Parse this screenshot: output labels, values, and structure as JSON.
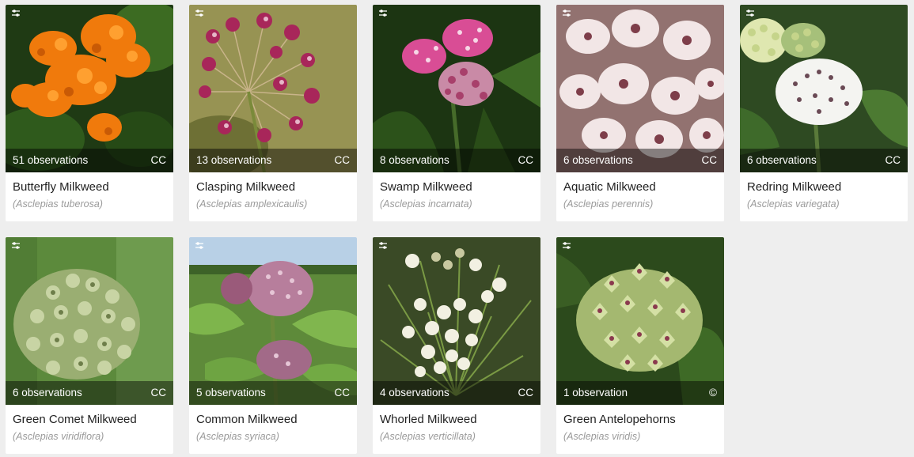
{
  "cards": [
    {
      "observations": "51 observations",
      "license": "CC",
      "common_name": "Butterfly Milkweed",
      "scientific_name": "(Asclepias tuberosa)",
      "photo": "orange-flower-cluster-photo"
    },
    {
      "observations": "13 observations",
      "license": "CC",
      "common_name": "Clasping Milkweed",
      "scientific_name": "(Asclepias amplexicaulis)",
      "photo": "pink-umbel-photo"
    },
    {
      "observations": "8 observations",
      "license": "CC",
      "common_name": "Swamp Milkweed",
      "scientific_name": "(Asclepias incarnata)",
      "photo": "magenta-flower-photo"
    },
    {
      "observations": "6 observations",
      "license": "CC",
      "common_name": "Aquatic Milkweed",
      "scientific_name": "(Asclepias perennis)",
      "photo": "white-pink-flower-photo"
    },
    {
      "observations": "6 observations",
      "license": "CC",
      "common_name": "Redring Milkweed",
      "scientific_name": "(Asclepias variegata)",
      "photo": "white-flower-ball-photo"
    },
    {
      "observations": "6 observations",
      "license": "CC",
      "common_name": "Green Comet Milkweed",
      "scientific_name": "(Asclepias viridiflora)",
      "photo": "green-flower-ball-photo"
    },
    {
      "observations": "5 observations",
      "license": "CC",
      "common_name": "Common Milkweed",
      "scientific_name": "(Asclepias syriaca)",
      "photo": "mauve-flower-field-photo"
    },
    {
      "observations": "4 observations",
      "license": "CC",
      "common_name": "Whorled Milkweed",
      "scientific_name": "(Asclepias verticillata)",
      "photo": "small-white-flowers-photo"
    },
    {
      "observations": "1 observation",
      "license": "©",
      "common_name": "Green Antelopehorns",
      "scientific_name": "(Asclepias viridis)",
      "photo": "green-star-flowers-photo"
    }
  ],
  "icons": {
    "filter": "sliders-icon"
  },
  "colors": {
    "background": "#eeeeee",
    "card": "#ffffff",
    "overlay": "rgba(0,0,0,0.45)",
    "scientific_name": "#9a9a9a"
  }
}
